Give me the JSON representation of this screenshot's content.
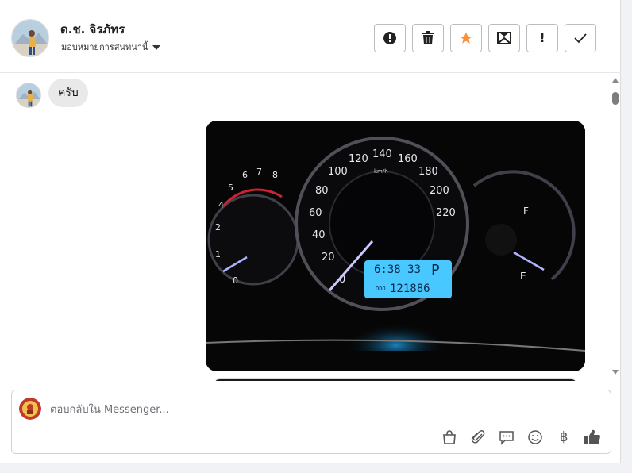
{
  "contact": {
    "name": "ด.ช. จิรภัทร",
    "assign_label": "มอบหมายการสนทนานี้"
  },
  "header_actions": [
    {
      "name": "spam-button",
      "icon": "alert-circle-icon"
    },
    {
      "name": "delete-button",
      "icon": "trash-icon"
    },
    {
      "name": "star-button",
      "icon": "star-icon",
      "color": "#f7923a"
    },
    {
      "name": "mark-unread-button",
      "icon": "envelope-icon"
    },
    {
      "name": "follow-up-button",
      "icon": "exclamation-icon",
      "glyph": "!"
    },
    {
      "name": "done-button",
      "icon": "check-icon"
    }
  ],
  "thread": {
    "messages": [
      {
        "type": "text",
        "text": "ครับ"
      },
      {
        "type": "image",
        "description_icon": "dashboard-photo"
      }
    ]
  },
  "composer": {
    "placeholder": "ตอบกลับใน Messenger...",
    "value": "",
    "tools": [
      "bag-icon",
      "paperclip-icon",
      "chat-bubble-icon",
      "smiley-icon",
      "baht-icon",
      "thumbs-up-icon"
    ],
    "baht_glyph": "฿"
  },
  "colors": {
    "star": "#f7923a",
    "dashboard_glow": "#48c8ff"
  }
}
